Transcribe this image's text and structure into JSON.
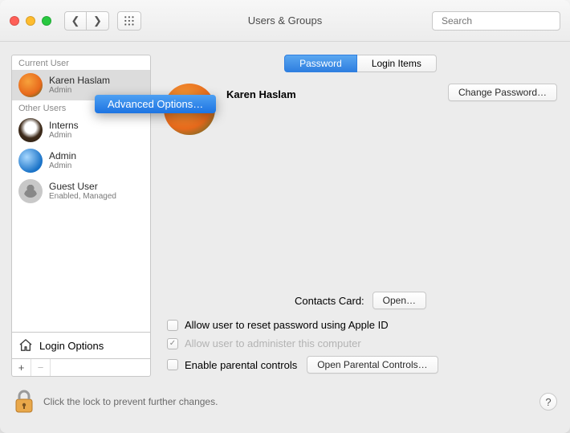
{
  "window": {
    "title": "Users & Groups"
  },
  "search": {
    "placeholder": "Search"
  },
  "tabs": {
    "password": "Password",
    "login_items": "Login Items"
  },
  "sidebar": {
    "current_header": "Current User",
    "other_header": "Other Users",
    "users": [
      {
        "name": "Karen Haslam",
        "role": "Admin"
      },
      {
        "name": "Interns",
        "role": "Admin"
      },
      {
        "name": "Admin",
        "role": "Admin"
      },
      {
        "name": "Guest User",
        "role": "Enabled, Managed"
      }
    ],
    "login_options": "Login Options"
  },
  "context_menu": {
    "label": "Advanced Options…"
  },
  "main": {
    "user_name": "Karen Haslam",
    "change_password": "Change Password…",
    "contacts_label": "Contacts Card:",
    "open": "Open…",
    "allow_reset": "Allow user to reset password using Apple ID",
    "allow_admin": "Allow user to administer this computer",
    "parental_label": "Enable parental controls",
    "open_parental": "Open Parental Controls…"
  },
  "footer": {
    "lock_text": "Click the lock to prevent further changes."
  }
}
